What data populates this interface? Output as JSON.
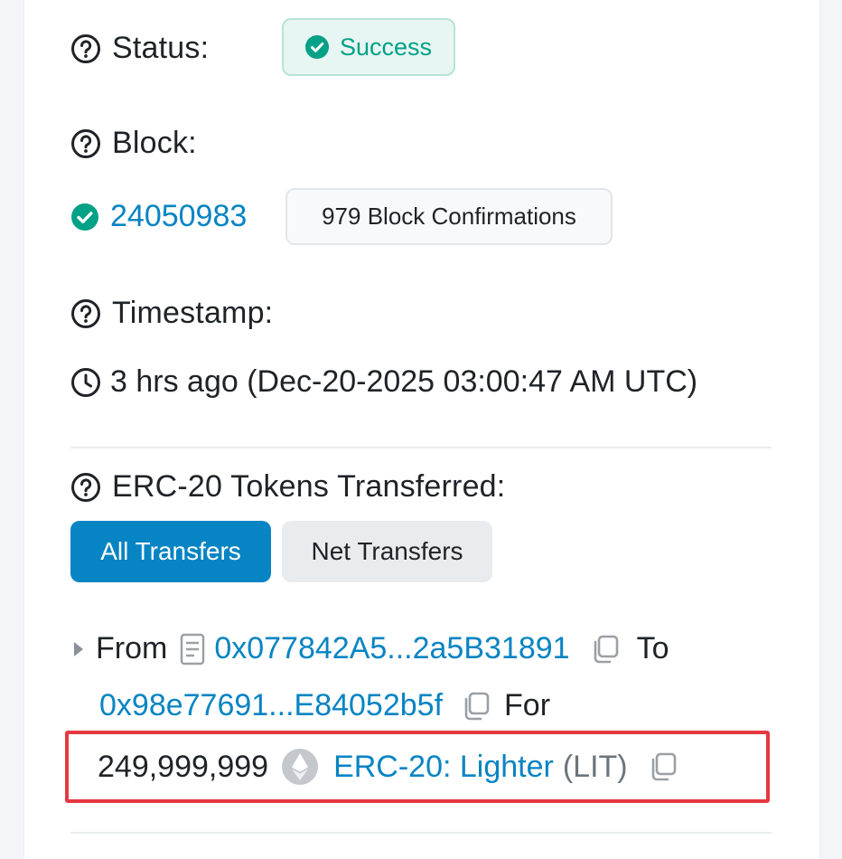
{
  "status": {
    "label": "Status:",
    "value": "Success"
  },
  "block": {
    "label": "Block:",
    "number": "24050983",
    "confirmations": "979 Block Confirmations"
  },
  "timestamp": {
    "label": "Timestamp:",
    "value": "3 hrs ago (Dec-20-2025 03:00:47 AM UTC)"
  },
  "tokens": {
    "label": "ERC-20 Tokens Transferred:",
    "tabs": {
      "all": "All Transfers",
      "net": "Net Transfers"
    },
    "transfer": {
      "from_label": "From",
      "from_address": "0x077842A5...2a5B31891",
      "to_label": "To",
      "to_address": "0x98e77691...E84052b5f",
      "for_label": "For",
      "amount": "249,999,999",
      "token_name": "ERC-20: Lighter",
      "token_symbol": "(LIT)"
    }
  },
  "colors": {
    "link": "#0784c3",
    "success": "#00a186",
    "highlight": "#e53940",
    "primary_button": "#0784c3"
  }
}
